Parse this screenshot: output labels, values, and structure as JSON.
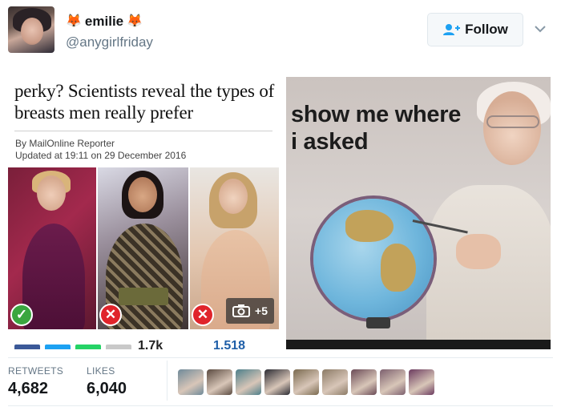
{
  "header": {
    "display_name": "emilie",
    "handle": "@anygirlfriday",
    "follow_label": "Follow",
    "emoji_left": "🦊",
    "emoji_right": "🦊"
  },
  "article": {
    "title": "perky? Scientists reveal the types of breasts men really prefer",
    "byline": "By MailOnline Reporter",
    "updated": "Updated at 19:11 on 29 December 2016",
    "gallery_count": "+5",
    "shares_label_left": "1.7k",
    "shares_label_right": "1,518"
  },
  "meme": {
    "text_line1": "show me where",
    "text_line2": "i asked"
  },
  "stats": {
    "retweets_label": "RETWEETS",
    "retweets_value": "4,682",
    "likes_label": "LIKES",
    "likes_value": "6,040"
  },
  "likers": [
    {
      "color": "#6f8a99"
    },
    {
      "color": "#5a4a40"
    },
    {
      "color": "#4d7f8a"
    },
    {
      "color": "#2b2b33"
    },
    {
      "color": "#7a6a4f"
    },
    {
      "color": "#8c7b66"
    },
    {
      "color": "#6a4a56"
    },
    {
      "color": "#7c5f6e"
    },
    {
      "color": "#6b3b5f"
    }
  ],
  "colors": {
    "accent": "#1da1f2",
    "muted_text": "#657786",
    "ok_mark": "#3aa63f",
    "bad_mark": "#e0242b"
  }
}
